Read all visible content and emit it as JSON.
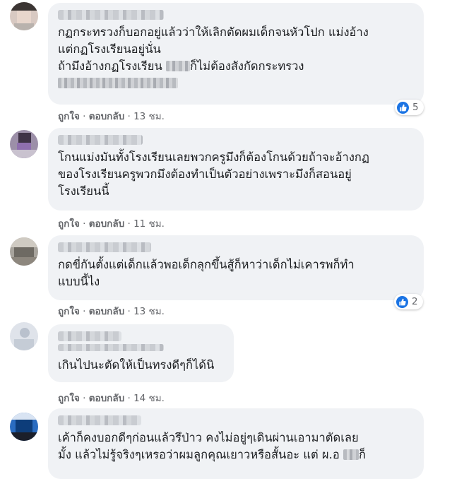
{
  "comments": [
    {
      "text_lines": [
        "กฏกระทรวงก็บอกอยู่แล้วว่าให้เลิกตัดผมเด็กจนหัวโปก แม่งอ้าง",
        "แต่กฏโรงเรียนอยู่นั่น"
      ],
      "line3_prefix": "ถ้ามึงอ้างกฏโรงเรียน",
      "line3_suffix": "ก็ไม่ต้องสังกัดกระทรวง",
      "like_label": "ถูกใจ",
      "reply_label": "ตอบกลับ",
      "time": "13 ชม.",
      "reaction_count": "5",
      "reaction_icon": "like-icon"
    },
    {
      "text_lines": [
        "โกนแม่งมันทั้งโรงเรียนเลยพวกครูมึงก็ต้องโกนด้วยถ้าจะอ้างกฏ",
        "ของโรงเรียนครูพวกมึงต้องทำเป็นตัวอย่างเพราะมึงก็สอนอยู่",
        "โรงเรียนนี้"
      ],
      "like_label": "ถูกใจ",
      "reply_label": "ตอบกลับ",
      "time": "11 ชม."
    },
    {
      "text_lines": [
        "กดขี่กันตั้งแต่เด็กแล้วพอเด็กลุกขึ้นสู้ก็หาว่าเด็กไม่เคารพก็ทำ",
        "แบบนี้ไง"
      ],
      "like_label": "ถูกใจ",
      "reply_label": "ตอบกลับ",
      "time": "13 ชม.",
      "reaction_count": "2",
      "reaction_icon": "like-icon"
    },
    {
      "text_lines": [
        "เกินไปนะตัดให้เป็นทรงดีๆก็ได้นิ"
      ],
      "like_label": "ถูกใจ",
      "reply_label": "ตอบกลับ",
      "time": "14 ชม."
    },
    {
      "line1": "เค้าก็คงบอกดีๆก่อนแล้วรึป่าว คงไม่อยู่ๆเดินผ่านเอามาตัดเลย",
      "line2_prefix": "มั้ง แล้วไม่รู้จริงๆเหรอว่าผมลูกคุณเยาวหรือสั้นอะ แต่ ผ.อ",
      "line2_suffix": "ก็"
    }
  ],
  "colors": {
    "bubble": "#f0f2f5",
    "text": "#1c1e21",
    "meta": "#65676b",
    "like_blue": "#1b74e4"
  }
}
